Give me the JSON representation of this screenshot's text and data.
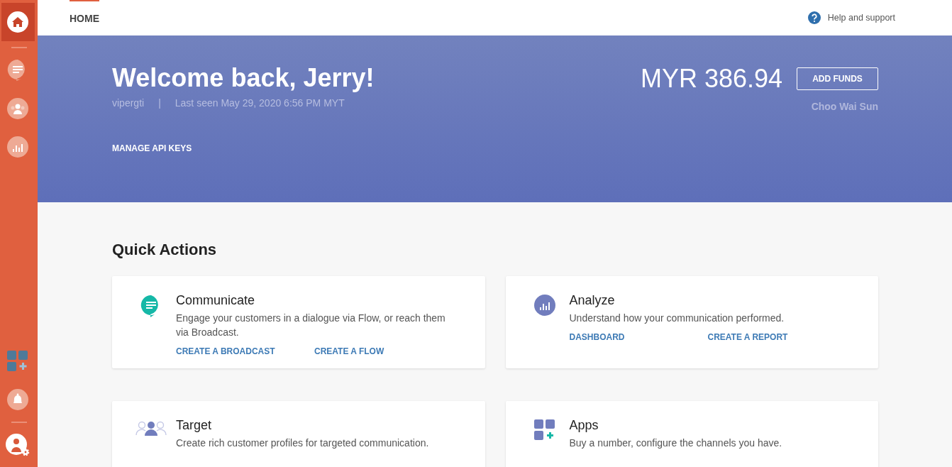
{
  "sidebar": {
    "items": [
      {
        "kind": "home",
        "selected": true
      },
      {
        "kind": "chat",
        "selected": false
      },
      {
        "kind": "people",
        "selected": false
      },
      {
        "kind": "chart",
        "selected": false
      }
    ],
    "bottom_items": [
      {
        "kind": "apps"
      },
      {
        "kind": "bell"
      },
      {
        "kind": "avatar"
      }
    ]
  },
  "tabs": [
    {
      "label": "HOME",
      "selected": true
    }
  ],
  "help": {
    "label": "Help and support"
  },
  "banner": {
    "title": "Welcome back, Jerry!",
    "username": "vipergti",
    "separator": "|",
    "last_seen": "Last seen May 29, 2020 6:56 PM MYT",
    "balance": "MYR 386.94",
    "add_funds": "ADD FUNDS",
    "account_name": "Choo Wai Sun",
    "link": "MANAGE API KEYS"
  },
  "quick_actions": {
    "title": "Quick Actions",
    "cards": [
      {
        "kind": "chat",
        "title": "Communicate",
        "description": "Engage your customers in a dialogue via Flow, or reach them via Broadcast.",
        "links": [
          "CREATE A BROADCAST",
          "CREATE A FLOW"
        ]
      },
      {
        "kind": "chart",
        "title": "Analyze",
        "description": "Understand how your communication performed.",
        "links": [
          "DASHBOARD",
          "CREATE A REPORT"
        ]
      },
      {
        "kind": "people",
        "title": "Target",
        "description": "Create rich customer profiles for targeted communication."
      },
      {
        "kind": "apps",
        "title": "Apps",
        "description": "Buy a number, configure the channels you have."
      }
    ]
  }
}
